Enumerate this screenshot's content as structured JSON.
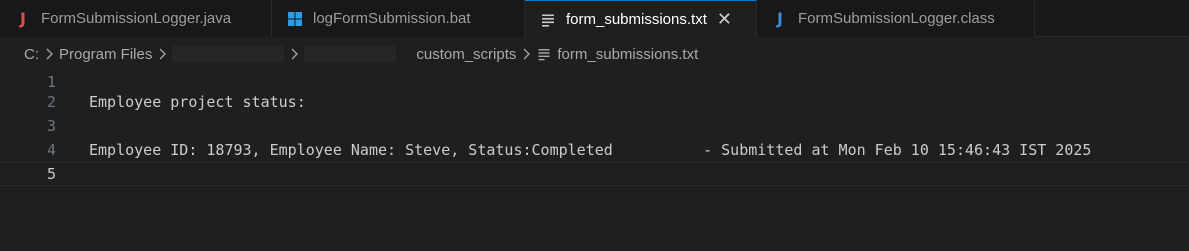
{
  "tabs": [
    {
      "label": "FormSubmissionLogger.java",
      "icon": "java-file-icon"
    },
    {
      "label": "logFormSubmission.bat",
      "icon": "windows-bat-file-icon"
    },
    {
      "label": "form_submissions.txt",
      "icon": "text-file-icon",
      "active": true
    },
    {
      "label": "FormSubmissionLogger.class",
      "icon": "class-file-icon"
    }
  ],
  "tab_icons": {
    "java": "J",
    "class": "J"
  },
  "close_glyph": "✕",
  "breadcrumb": {
    "drive": "C:",
    "program_files": "Program Files",
    "custom_scripts": "custom_scripts",
    "file": "form_submissions.txt"
  },
  "editor": {
    "lines": [
      {
        "number": "1",
        "text": ""
      },
      {
        "number": "2",
        "text": "Employee project status:"
      },
      {
        "number": "3",
        "text": ""
      },
      {
        "number": "4",
        "text": "Employee ID: 18793, Employee Name: Steve, Status:Completed          - Submitted at Mon Feb 10 15:46:43 IST 2025"
      },
      {
        "number": "5",
        "text": ""
      }
    ]
  },
  "colors": {
    "background": "#1f1f1f",
    "active_tab_accent": "#0078d4",
    "java_icon": "#e04c4c",
    "class_icon": "#3d8ad8",
    "windows_icon": "#2f9be3"
  }
}
